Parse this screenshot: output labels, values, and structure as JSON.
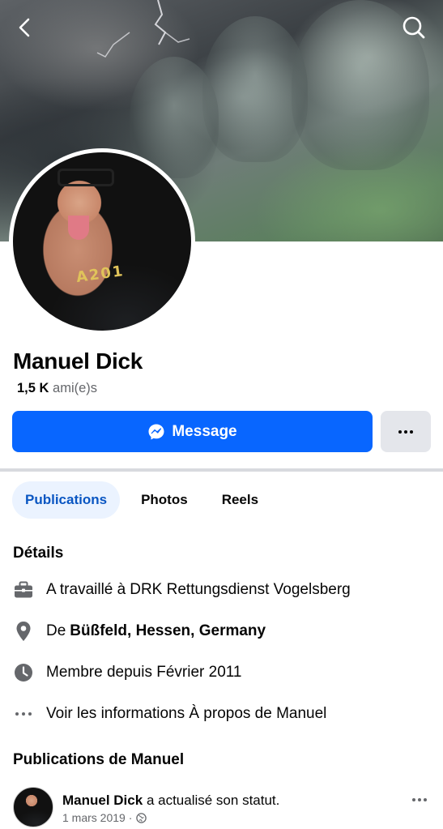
{
  "profile": {
    "name": "Manuel Dick",
    "friends_count": "1,5 K",
    "friends_label": "ami(e)s"
  },
  "actions": {
    "message_label": "Message",
    "more_label": "···"
  },
  "tabs": [
    {
      "label": "Publications",
      "active": true
    },
    {
      "label": "Photos",
      "active": false
    },
    {
      "label": "Reels",
      "active": false
    }
  ],
  "details": {
    "title": "Détails",
    "work_prefix": "A travaillé à",
    "work_place": "DRK Rettungsdienst Vogelsberg",
    "from_prefix": "De",
    "from_place": "Büßfeld, Hessen, Germany",
    "member_since": "Membre depuis Février 2011",
    "about_link": "Voir les informations À propos de Manuel"
  },
  "posts": {
    "title": "Publications de Manuel",
    "first": {
      "author": "Manuel Dick",
      "action": "a actualisé son statut.",
      "date": "1 mars 2019 ·"
    }
  },
  "colors": {
    "primary": "#0866ff",
    "tab_active_bg": "#ebf3ff",
    "tab_active_text": "#0a56c2",
    "secondary_btn": "#e4e6eb",
    "muted_text": "#65676b"
  },
  "icons": {
    "back": "chevron-left-icon",
    "search": "search-icon",
    "messenger": "messenger-icon",
    "work": "briefcase-icon",
    "location": "location-pin-icon",
    "member": "clock-icon",
    "about": "dots-icon",
    "privacy": "globe-icon"
  }
}
